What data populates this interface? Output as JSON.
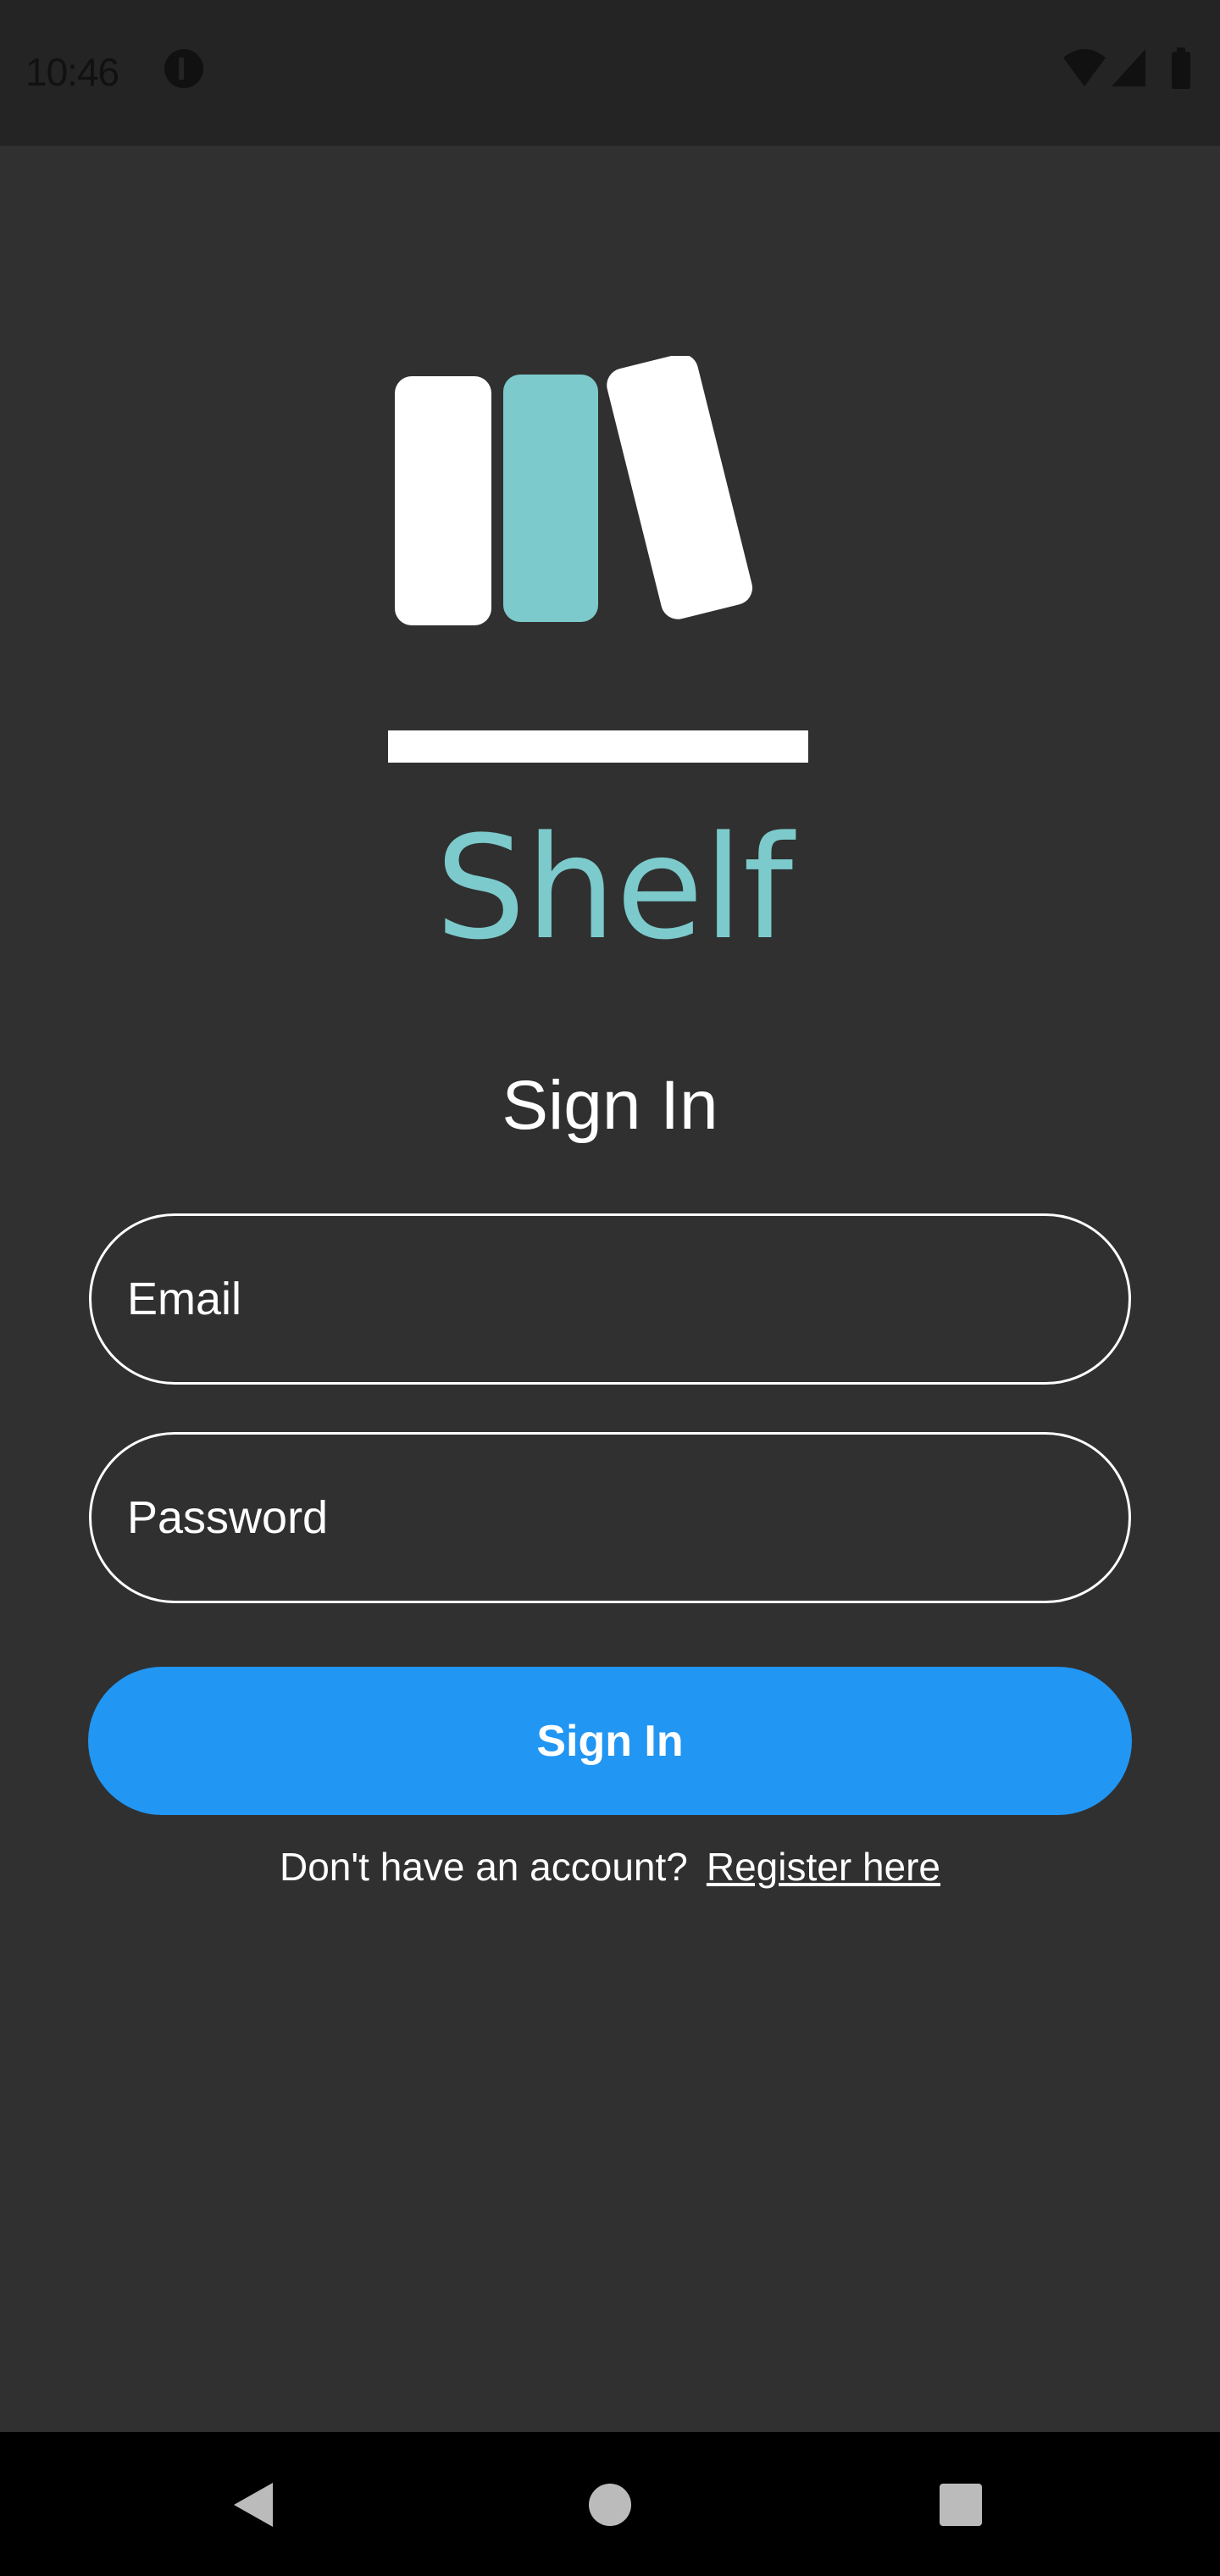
{
  "status_bar": {
    "time": "10:46"
  },
  "app": {
    "name": "Shelf",
    "accent": "#7ccacc"
  },
  "form": {
    "title": "Sign In",
    "email_placeholder": "Email",
    "password_placeholder": "Password",
    "submit_label": "Sign In",
    "submit_color": "#2196f3"
  },
  "register": {
    "prompt": "Don't have an account?",
    "link_label": "Register here"
  }
}
